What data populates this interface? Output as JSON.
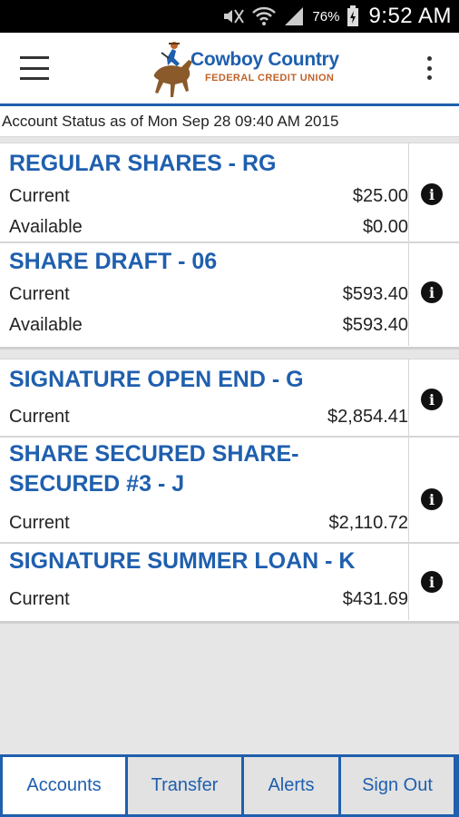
{
  "status_bar": {
    "battery": "76%",
    "time": "9:52 AM"
  },
  "header": {
    "logo_line1": "Cowboy Country",
    "logo_line2": "FEDERAL CREDIT UNION"
  },
  "status_line": "Account Status as of Mon Sep 28 09:40 AM 2015",
  "groups": [
    {
      "accounts": [
        {
          "name": "REGULAR SHARES - RG",
          "rows": [
            {
              "label": "Current",
              "value": "$25.00"
            },
            {
              "label": "Available",
              "value": "$0.00"
            }
          ]
        },
        {
          "name": "SHARE DRAFT - 06",
          "rows": [
            {
              "label": "Current",
              "value": "$593.40"
            },
            {
              "label": "Available",
              "value": "$593.40"
            }
          ]
        }
      ]
    },
    {
      "accounts": [
        {
          "name": "SIGNATURE OPEN END - G",
          "rows": [
            {
              "label": "Current",
              "value": "$2,854.41"
            }
          ]
        },
        {
          "name_line1": "SHARE SECURED SHARE-",
          "name_line2": "SECURED #3 - J",
          "rows": [
            {
              "label": "Current",
              "value": "$2,110.72"
            }
          ]
        },
        {
          "name": "SIGNATURE SUMMER LOAN - K",
          "rows": [
            {
              "label": "Current",
              "value": "$431.69"
            }
          ]
        }
      ]
    }
  ],
  "tabs": [
    {
      "label": "Accounts",
      "active": true
    },
    {
      "label": "Transfer"
    },
    {
      "label": "Alerts"
    },
    {
      "label": "Sign Out"
    }
  ],
  "icons": {
    "info": "i"
  },
  "colors": {
    "brand_blue": "#1f5fae",
    "brand_orange": "#c0632a"
  }
}
